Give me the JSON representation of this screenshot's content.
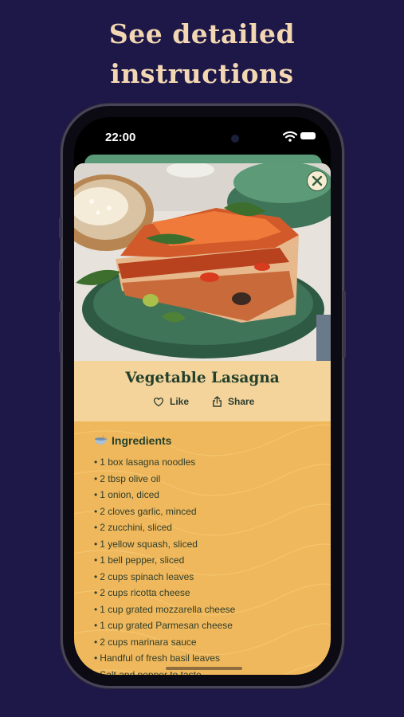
{
  "promo": {
    "line1": "See detailed",
    "line2": "instructions"
  },
  "status_bar": {
    "time": "22:00",
    "icons": [
      "wifi-icon",
      "battery-icon"
    ]
  },
  "recipe": {
    "title": "Vegetable Lasagna",
    "like_label": "Like",
    "share_label": "Share",
    "image": "lasagna-photo",
    "close_icon": "close-icon"
  },
  "ingredients": {
    "heading": "Ingredients",
    "heading_icon": "bowl-icon",
    "items": [
      "1 box lasagna noodles",
      "2 tbsp olive oil",
      "1 onion, diced",
      "2 cloves garlic, minced",
      "2 zucchini, sliced",
      "1 yellow squash, sliced",
      "1 bell pepper, sliced",
      "2 cups spinach leaves",
      "2 cups ricotta cheese",
      "1 cup grated mozzarella cheese",
      "1 cup grated Parmesan cheese",
      "2 cups marinara sauce",
      "Handful of fresh basil leaves",
      "Salt and pepper to taste"
    ]
  },
  "colors": {
    "background": "#1e1848",
    "promo_text": "#f2d7b2",
    "card": "#f0b85c",
    "title_panel": "#f4d49b",
    "accent_green": "#23402c"
  }
}
